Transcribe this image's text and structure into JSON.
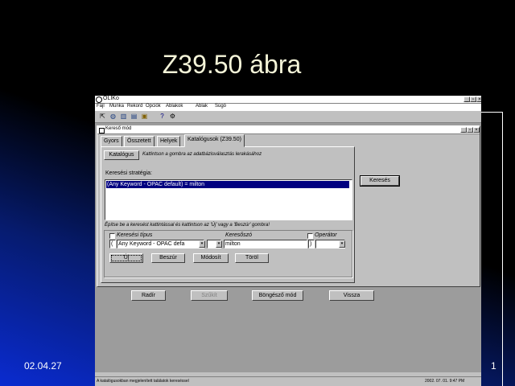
{
  "slide": {
    "title": "Z39.50 ábra",
    "date": "02.04.27",
    "page_number": "1"
  },
  "window": {
    "title": "OLIKo",
    "menu": [
      "Fájl",
      "Munka",
      "Rekord",
      "Opciók",
      "Ablakok",
      "Ablak",
      "Súgó"
    ],
    "toolbar_icons": [
      "exit-icon",
      "globe-icon",
      "books-icon",
      "catalog-icon",
      "lock-icon",
      "help-icon",
      "settings-icon"
    ]
  },
  "child": {
    "title": "Kereső mód",
    "tabs": [
      "Gyors",
      "Összetett",
      "Helyek",
      "Katalógusok (Z39.50)"
    ],
    "active_tab": 3,
    "katalogus_button": "Katalógus",
    "katalogus_hint": "Kattintson a gombra az adatbázisválasztás lerakásához",
    "strategy_label": "Keresési stratégia:",
    "strategy_row": "(Any Keyword - OPAC default) = milton",
    "instruction": "Építse be a keresést kattintással és kattintson az 'Új' vagy a 'Beszúr' gombra!",
    "keresesi_tipus_label": "Keresési típus",
    "keresoszo_label": "Keresőszó",
    "operator_label": "Operátor",
    "type_value": "Any Keyword - OPAC defa",
    "keyword_value": "milton",
    "paren_open": "(",
    "paren_close": ")",
    "buttons": {
      "uj": "Új",
      "beszur": "Beszúr",
      "modosit": "Módosít",
      "torol": "Töröl"
    },
    "kereses_button": "Keresés"
  },
  "bottom_buttons": [
    "Radír",
    "Szűkít",
    "Böngésző mód",
    "Vissza"
  ],
  "status": {
    "left": "A katalógusokban megjelenített találatok kereséssel",
    "right": "2002. 07. 01.    9:47 PM"
  }
}
